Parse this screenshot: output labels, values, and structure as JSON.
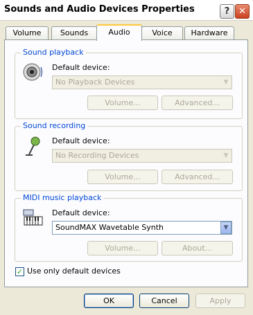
{
  "window": {
    "title": "Sounds and Audio Devices Properties",
    "help_glyph": "?",
    "close_glyph": "✕"
  },
  "tabs": [
    {
      "label": "Volume"
    },
    {
      "label": "Sounds"
    },
    {
      "label": "Audio",
      "active": true
    },
    {
      "label": "Voice"
    },
    {
      "label": "Hardware"
    }
  ],
  "sound_playback": {
    "title": "Sound playback",
    "icon": "speaker-icon",
    "default_label": "Default device:",
    "device": "No Playback Devices",
    "volume_button": "Volume...",
    "advanced_button": "Advanced..."
  },
  "sound_recording": {
    "title": "Sound recording",
    "icon": "microphone-icon",
    "default_label": "Default device:",
    "device": "No Recording Devices",
    "volume_button": "Volume...",
    "advanced_button": "Advanced..."
  },
  "midi_playback": {
    "title": "MIDI music playback",
    "icon": "midi-keyboard-icon",
    "default_label": "Default device:",
    "device": "SoundMAX Wavetable Synth",
    "volume_button": "Volume...",
    "about_button": "About..."
  },
  "use_default_only": {
    "label": "Use only default devices",
    "checked": true,
    "mark": "✓"
  },
  "footer": {
    "ok": "OK",
    "cancel": "Cancel",
    "apply": "Apply"
  },
  "colors": {
    "group_title": "#0046d5",
    "active_tab_accent": "#ffc83c",
    "dialog_bg": "#ece9d8"
  }
}
